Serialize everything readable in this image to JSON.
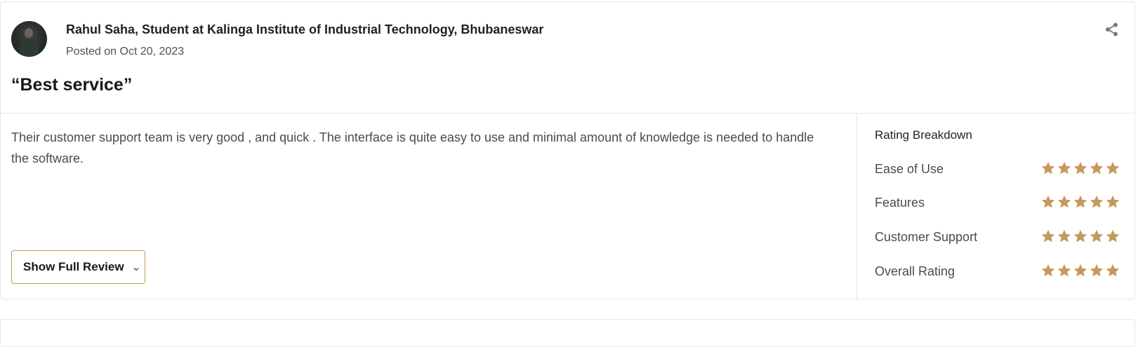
{
  "review": {
    "reviewer": "Rahul Saha, Student at Kalinga Institute of Industrial Technology, Bhubaneswar",
    "posted": "Posted on Oct 20, 2023",
    "title": "“Best service”",
    "body": "Their customer support team is very good , and quick . The interface is quite easy to use and minimal amount of knowledge is needed to handle the software.",
    "show_full_label": "Show Full Review",
    "icons": {
      "share": "share-icon",
      "chevron": "chevron-down-icon",
      "star": "star-icon"
    },
    "star_color": "#c49a5b"
  },
  "breakdown": {
    "title": "Rating Breakdown",
    "max": 5,
    "items": [
      {
        "label": "Ease of Use",
        "rating": 5
      },
      {
        "label": "Features",
        "rating": 5
      },
      {
        "label": "Customer Support",
        "rating": 5
      },
      {
        "label": "Overall Rating",
        "rating": 5
      }
    ]
  }
}
